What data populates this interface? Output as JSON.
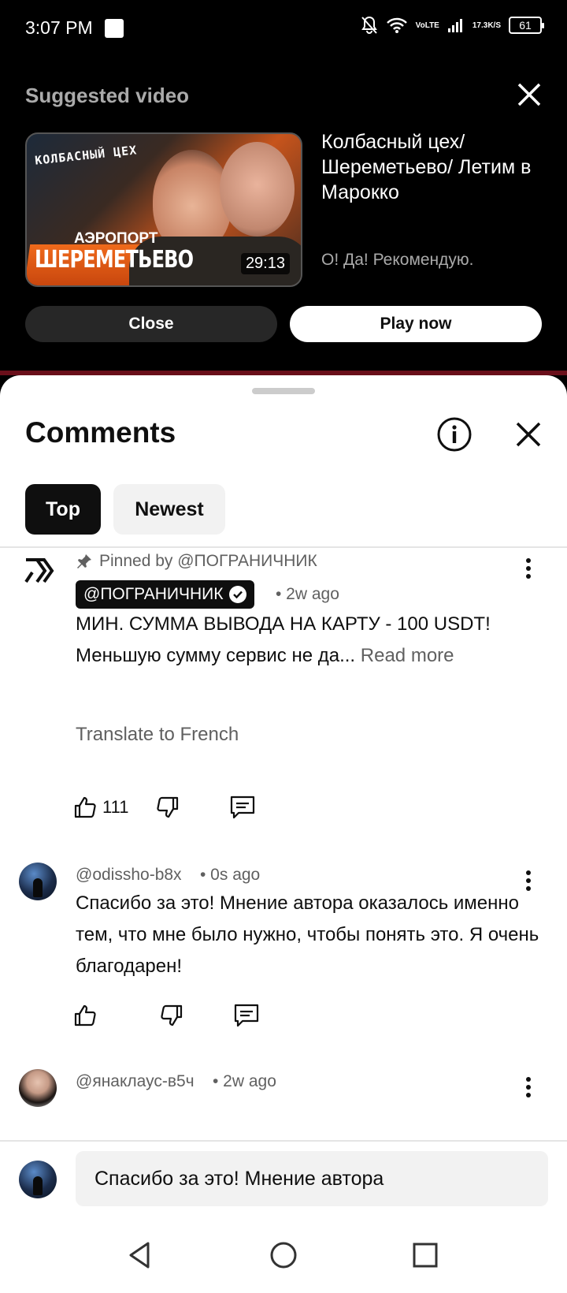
{
  "status_bar": {
    "time": "3:07 PM",
    "net_top": "Vo",
    "net_bottom": "LTE",
    "speed_top": "17.3",
    "speed_bottom": "K/S",
    "battery": "61"
  },
  "suggested": {
    "header": "Suggested video",
    "thumb_sign": "КОЛБАСНЫЙ ЦЕХ",
    "thumb_line1": "АЭРОПОРТ",
    "thumb_line2": "ШЕРЕМЕТЬЕВО",
    "duration": "29:13",
    "title": "Колбасный цех/ Шереметьево/ Летим в Марокко",
    "description": "О! Да! Рекомендую.",
    "close_label": "Close",
    "play_label": "Play now"
  },
  "comments": {
    "title": "Comments",
    "chips": [
      "Top",
      "Newest"
    ],
    "pinned": {
      "pinned_label": "Pinned by @ПОГРАНИЧНИК",
      "author": "@ПОГРАНИЧНИК",
      "time": "• 2w ago",
      "text_line1": "МИН. СУММА ВЫВОДА НА КАРТУ - 100 USDT!",
      "text_line2": "Меньшую сумму сервис не да...",
      "read_more": "Read more",
      "translate": "Translate to French",
      "likes": "111"
    },
    "second": {
      "author": "@odissho-b8x",
      "time": "• 0s ago",
      "text": "Спасибо за это! Мнение автора оказалось именно тем, что мне было нужно, чтобы понять это. Я очень благодарен!"
    },
    "third": {
      "author": "@янаклаус-в5ч",
      "time": "• 2w ago"
    },
    "composer_text": "Спасибо за это! Мнение автора"
  },
  "icons": {
    "pin": "pin-icon",
    "like": "thumb-up-icon",
    "dislike": "thumb-down-icon",
    "reply": "reply-icon",
    "more": "more-vert-icon",
    "info": "info-icon",
    "close": "close-icon",
    "nav_back": "back-triangle-icon",
    "nav_home": "home-circle-icon",
    "nav_recents": "recents-square-icon"
  }
}
